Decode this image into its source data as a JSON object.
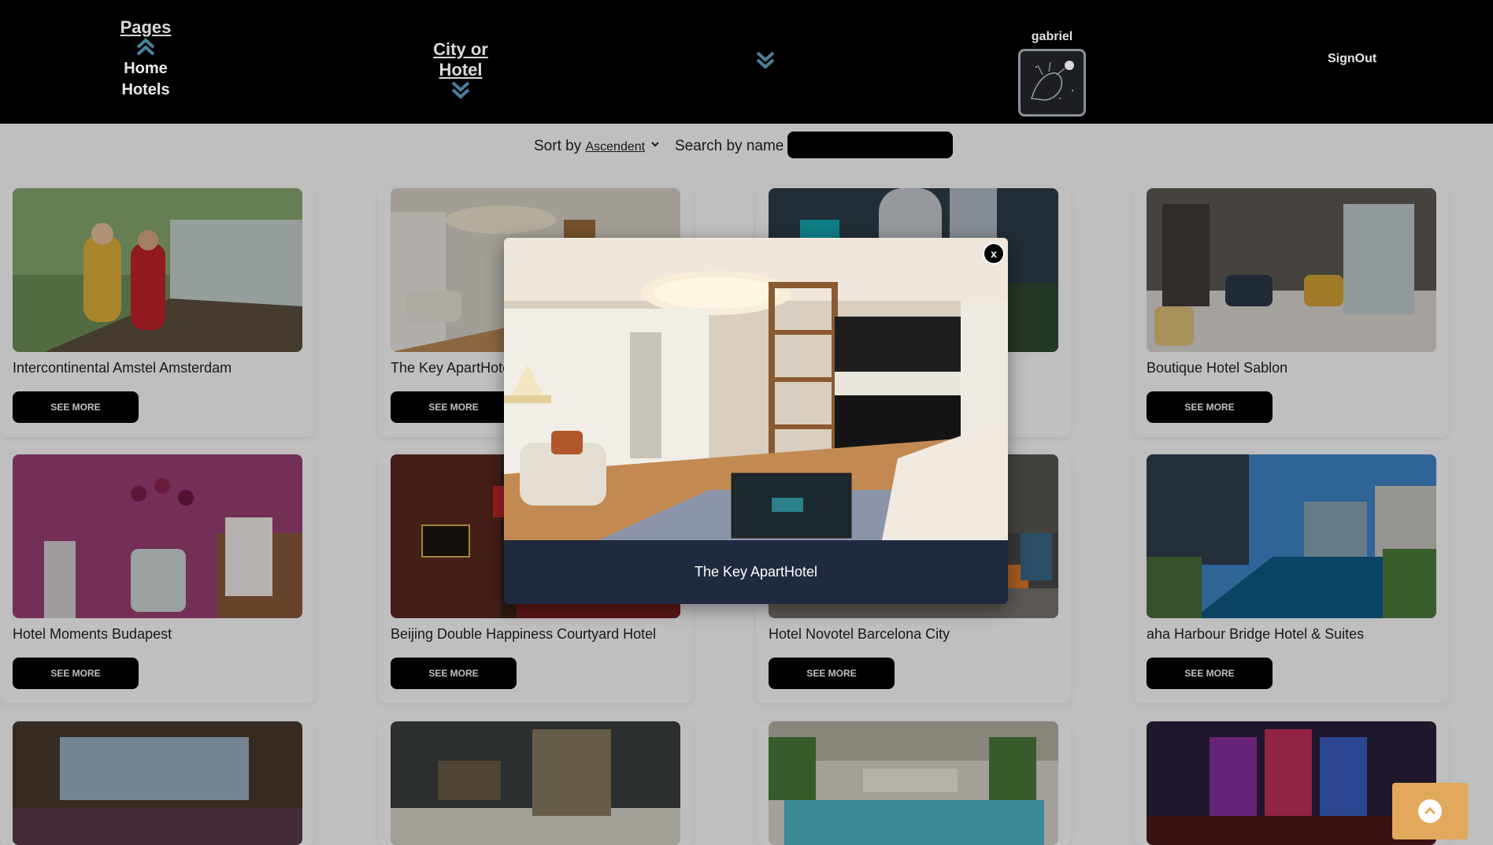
{
  "header": {
    "pages_label": "Pages",
    "nav_items": [
      "Home",
      "Hotels"
    ],
    "city_label": "City or Hotel",
    "username": "gabriel",
    "signout_label": "SignOut"
  },
  "toolbar": {
    "sort_prefix": "Sort by",
    "sort_value": "Ascendent",
    "search_label": "Search by name",
    "search_value": ""
  },
  "hotels": [
    {
      "name": "Intercontinental Amstel Amsterdam",
      "button": "SEE MORE"
    },
    {
      "name": "The Key ApartHotel",
      "button": "SEE MORE"
    },
    {
      "name": "",
      "button": ""
    },
    {
      "name": "Boutique Hotel Sablon",
      "button": "SEE MORE"
    },
    {
      "name": "Hotel Moments Budapest",
      "button": "SEE MORE"
    },
    {
      "name": "Beijing Double Happiness Courtyard Hotel",
      "button": "SEE MORE"
    },
    {
      "name": "Hotel Novotel Barcelona City",
      "button": "SEE MORE"
    },
    {
      "name": "aha Harbour Bridge Hotel & Suites",
      "button": "SEE MORE"
    }
  ],
  "modal": {
    "caption": "The Key ApartHotel",
    "close_label": "x"
  },
  "colors": {
    "header_bg": "#000000",
    "chevron": "#4a7f9b",
    "modal_caption_bg": "#1f2a40",
    "scroll_top_bg": "#e2a85c"
  },
  "icons": [
    "chevron-up-double-icon",
    "chevron-down-double-icon",
    "caret-down-icon",
    "close-icon",
    "arrow-up-icon"
  ]
}
